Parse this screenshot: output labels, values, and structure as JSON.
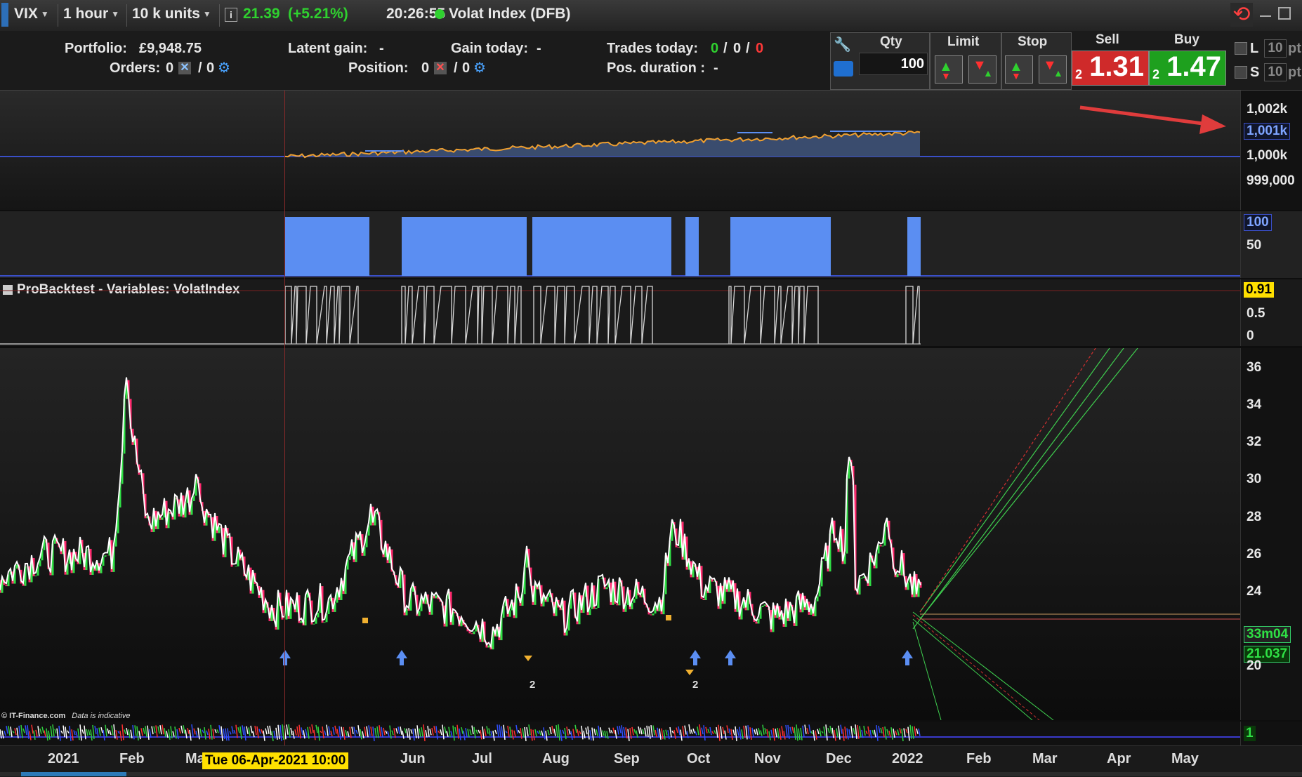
{
  "toolbar": {
    "symbol": "VIX",
    "timeframe": "1 hour",
    "units": "10 k units",
    "last_price": "21.39",
    "change": "(+5.21%)",
    "time": "20:26:55",
    "instrument": "Volat Index (DFB)"
  },
  "account": {
    "portfolio_label": "Portfolio:",
    "portfolio_value": "£9,948.75",
    "orders_label": "Orders:",
    "orders_count": "0",
    "orders_slash": "/",
    "orders_count2": "0",
    "latent_label": "Latent gain:",
    "latent_value": "-",
    "position_label": "Position:",
    "position_count": "0",
    "position_slash": "/",
    "position_count2": "0",
    "gain_today_label": "Gain today:",
    "gain_today_value": "-",
    "trades_today_label": "Trades today:",
    "trades_a": "0",
    "trades_b": "0",
    "trades_c": "0",
    "trades_sep": "/",
    "pos_duration_label": "Pos. duration :",
    "pos_duration_value": "-"
  },
  "order_panel": {
    "qty_label": "Qty",
    "qty_value": "100",
    "limit_label": "Limit",
    "stop_label": "Stop",
    "sell_label": "Sell",
    "buy_label": "Buy",
    "sell_small": "2",
    "sell_big": "1.31",
    "buy_small": "2",
    "buy_big": "1.47",
    "l_label": "L",
    "s_label": "S",
    "l_pts": "10",
    "s_pts": "10",
    "pts_unit": "pt"
  },
  "equity_axis": {
    "ticks": [
      "1,002k",
      "1,000k",
      "999,000"
    ],
    "current": "1,001k"
  },
  "position_axis": {
    "current": "100",
    "ticks": [
      "50"
    ]
  },
  "variables": {
    "title": "ProBacktest - Variables: VolatIndex",
    "current": "0.91",
    "ticks": [
      "0.5",
      "0"
    ]
  },
  "price_axis": {
    "ticks": [
      "36",
      "34",
      "32",
      "30",
      "28",
      "26",
      "24",
      "20"
    ],
    "countdown": "33m04",
    "price": "21.037"
  },
  "watermark": {
    "source": "© IT-Finance.com",
    "note": "Data is indicative"
  },
  "volume_axis": {
    "value": "1"
  },
  "cursor_label": "Tue 06-Apr-2021 10:00",
  "months": [
    "2021",
    "Feb",
    "Ma",
    "Jun",
    "Jul",
    "Aug",
    "Sep",
    "Oct",
    "Nov",
    "Dec",
    "2022",
    "Feb",
    "Mar",
    "Apr",
    "May"
  ],
  "marker_counts": [
    "2",
    "2"
  ],
  "colors": {
    "equity_line": "#f0a030",
    "equity_fill": "#3a4c6e",
    "position_bars": "#5b8ef2",
    "candle_up": "#2fe045",
    "candle_down": "#ff2a6e",
    "sell_bg": "#cf2a2a",
    "buy_bg": "#1ea01e",
    "arrow": "#e03c3c"
  }
}
